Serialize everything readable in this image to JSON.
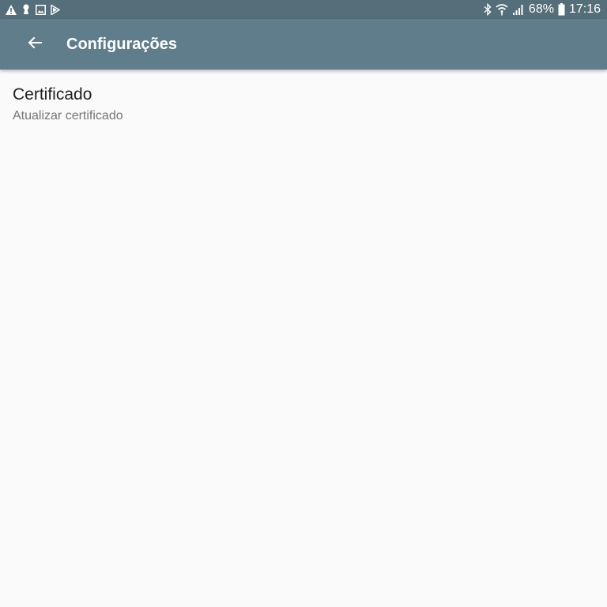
{
  "status_bar": {
    "left_icons": [
      "warning-icon",
      "keyhole-icon",
      "image-icon",
      "play-store-icon"
    ],
    "right_icons": [
      "bluetooth-icon",
      "wifi-icon",
      "signal-icon",
      "battery-icon"
    ],
    "battery": "68%",
    "time": "17:16"
  },
  "app_bar": {
    "back_icon": "arrow-back-icon",
    "title": "Configurações"
  },
  "preferences": [
    {
      "title": "Certificado",
      "summary": "Atualizar certificado"
    }
  ],
  "colors": {
    "status_bar": "#546e7a",
    "app_bar": "#607d8b",
    "background": "#fafafa",
    "title_text": "#212121",
    "summary_text": "#757575"
  }
}
